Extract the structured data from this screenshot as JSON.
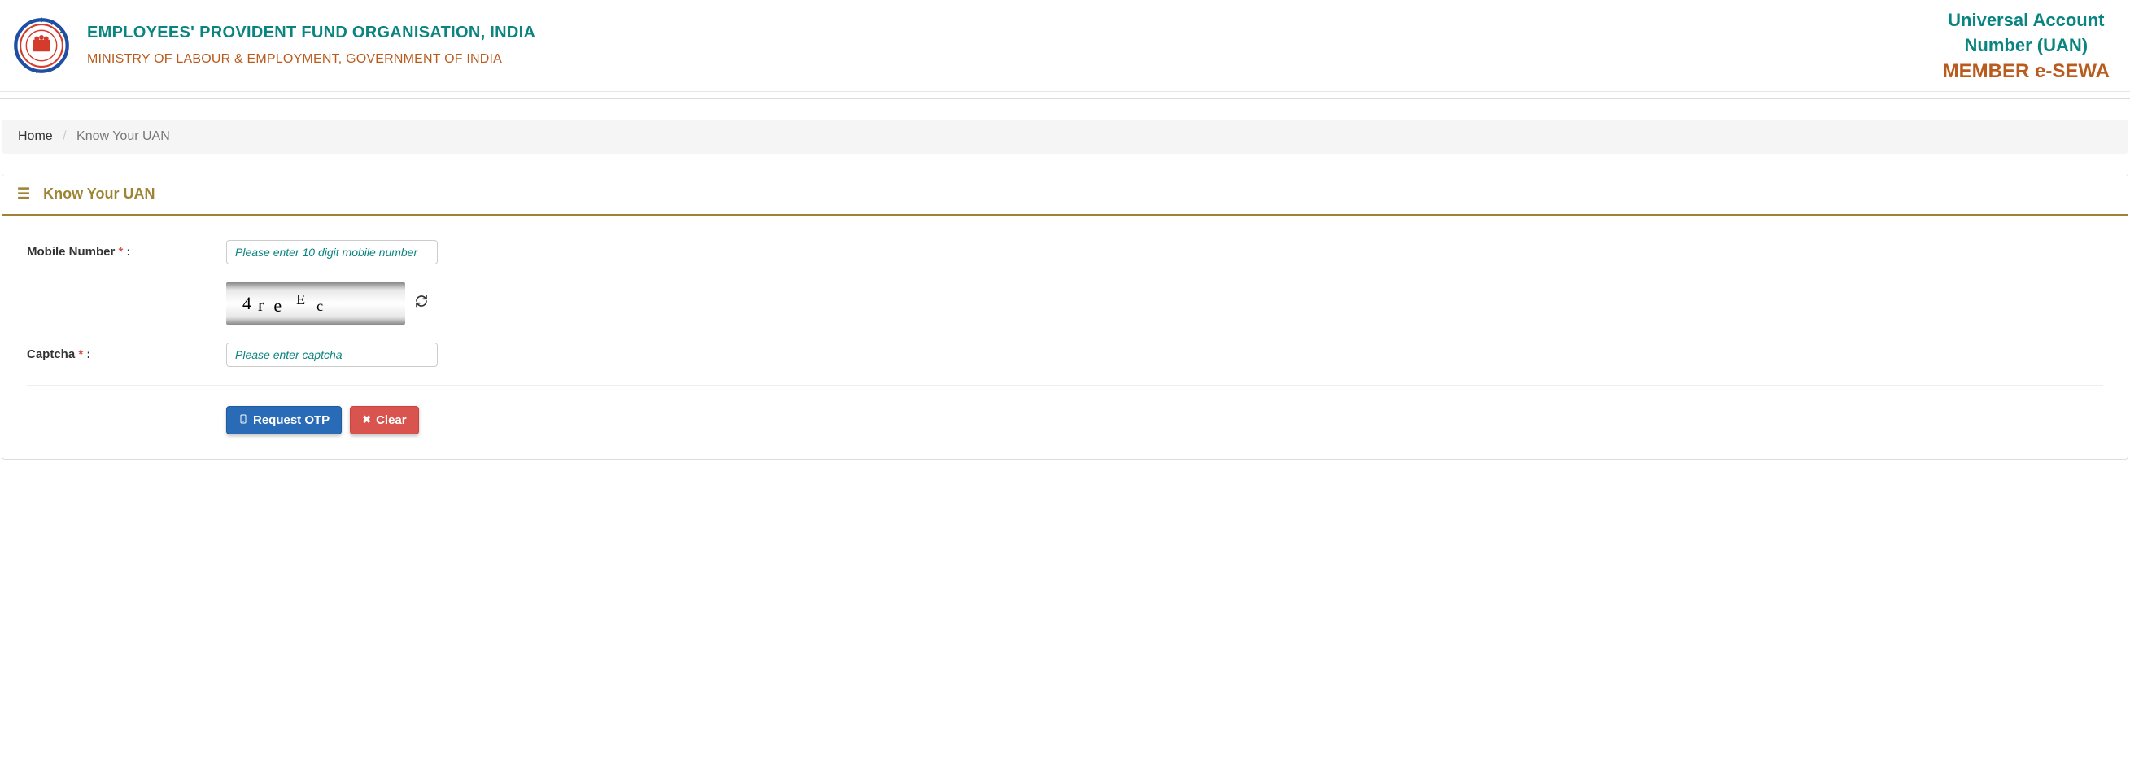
{
  "header": {
    "org_title": "EMPLOYEES' PROVIDENT FUND ORGANISATION, INDIA",
    "org_subtitle": "MINISTRY OF LABOUR & EMPLOYMENT, GOVERNMENT OF INDIA",
    "uan_line1": "Universal Account",
    "uan_line2": "Number (UAN)",
    "esewa": "MEMBER e-SEWA"
  },
  "breadcrumb": {
    "home": "Home",
    "current": "Know Your UAN"
  },
  "panel": {
    "title": "Know Your UAN"
  },
  "form": {
    "mobile_label": "Mobile Number",
    "mobile_placeholder": "Please enter 10 digit mobile number",
    "captcha_label": "Captcha",
    "captcha_placeholder": "Please enter captcha",
    "captcha_text": "4r e E c",
    "request_otp_label": "Request OTP",
    "clear_label": "Clear",
    "required_mark": "*",
    "colon": " :"
  }
}
